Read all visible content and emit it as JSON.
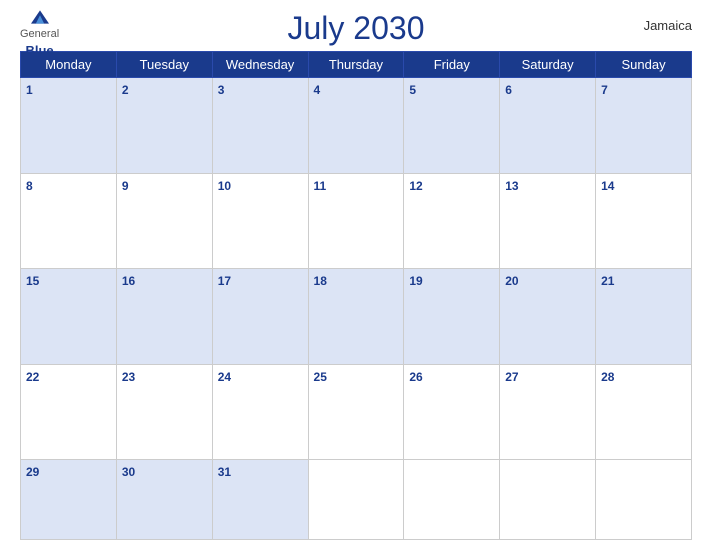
{
  "header": {
    "title": "July 2030",
    "country": "Jamaica",
    "logo": {
      "general": "General",
      "blue": "Blue"
    }
  },
  "days_of_week": [
    "Monday",
    "Tuesday",
    "Wednesday",
    "Thursday",
    "Friday",
    "Saturday",
    "Sunday"
  ],
  "weeks": [
    [
      {
        "date": "1",
        "empty": false
      },
      {
        "date": "2",
        "empty": false
      },
      {
        "date": "3",
        "empty": false
      },
      {
        "date": "4",
        "empty": false
      },
      {
        "date": "5",
        "empty": false
      },
      {
        "date": "6",
        "empty": false
      },
      {
        "date": "7",
        "empty": false
      }
    ],
    [
      {
        "date": "8",
        "empty": false
      },
      {
        "date": "9",
        "empty": false
      },
      {
        "date": "10",
        "empty": false
      },
      {
        "date": "11",
        "empty": false
      },
      {
        "date": "12",
        "empty": false
      },
      {
        "date": "13",
        "empty": false
      },
      {
        "date": "14",
        "empty": false
      }
    ],
    [
      {
        "date": "15",
        "empty": false
      },
      {
        "date": "16",
        "empty": false
      },
      {
        "date": "17",
        "empty": false
      },
      {
        "date": "18",
        "empty": false
      },
      {
        "date": "19",
        "empty": false
      },
      {
        "date": "20",
        "empty": false
      },
      {
        "date": "21",
        "empty": false
      }
    ],
    [
      {
        "date": "22",
        "empty": false
      },
      {
        "date": "23",
        "empty": false
      },
      {
        "date": "24",
        "empty": false
      },
      {
        "date": "25",
        "empty": false
      },
      {
        "date": "26",
        "empty": false
      },
      {
        "date": "27",
        "empty": false
      },
      {
        "date": "28",
        "empty": false
      }
    ],
    [
      {
        "date": "29",
        "empty": false
      },
      {
        "date": "30",
        "empty": false
      },
      {
        "date": "31",
        "empty": false
      },
      {
        "date": "",
        "empty": true
      },
      {
        "date": "",
        "empty": true
      },
      {
        "date": "",
        "empty": true
      },
      {
        "date": "",
        "empty": true
      }
    ]
  ]
}
